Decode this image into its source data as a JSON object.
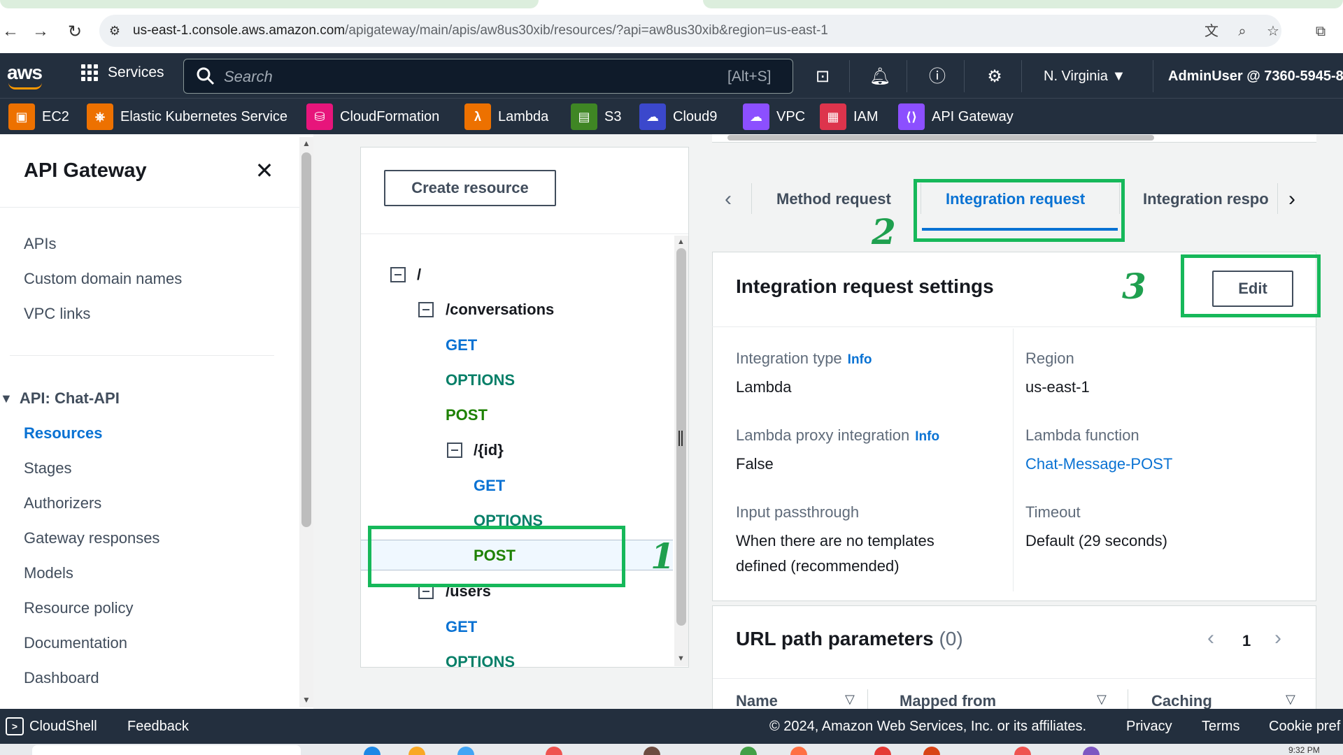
{
  "browser": {
    "url_host": "us-east-1.console.aws.amazon.com",
    "url_path": "/apigateway/main/apis/aw8us30xib/resources/?api=aw8us30xib&region=us-east-1",
    "back_icon": "arrow-left-icon",
    "forward_icon": "arrow-right-icon",
    "reload_icon": "reload-icon",
    "translate_icon": "translate-icon",
    "zoom_icon": "zoom-icon",
    "bookmark_icon": "star-icon",
    "extensions_icon": "puzzle-icon"
  },
  "awsnav": {
    "logo": "aws",
    "services_label": "Services",
    "search_placeholder": "Search",
    "search_shortcut": "[Alt+S]",
    "region_label": "N. Virginia ▼",
    "account_label": "AdminUser @ 7360-5945-8"
  },
  "favorites": [
    {
      "label": "EC2",
      "color": "#ed7100",
      "glyph": "▣"
    },
    {
      "label": "Elastic Kubernetes Service",
      "color": "#ed7100",
      "glyph": "⎈"
    },
    {
      "label": "CloudFormation",
      "color": "#e7157b",
      "glyph": "⛁"
    },
    {
      "label": "Lambda",
      "color": "#ed7100",
      "glyph": "λ"
    },
    {
      "label": "S3",
      "color": "#3f8624",
      "glyph": "▤"
    },
    {
      "label": "Cloud9",
      "color": "#3b48cc",
      "glyph": "☁"
    },
    {
      "label": "VPC",
      "color": "#8c4fff",
      "glyph": "☁"
    },
    {
      "label": "IAM",
      "color": "#dd344c",
      "glyph": "▦"
    },
    {
      "label": "API Gateway",
      "color": "#8c4fff",
      "glyph": "⟨⟩"
    }
  ],
  "sidebar": {
    "title": "API Gateway",
    "top_items": [
      "APIs",
      "Custom domain names",
      "VPC links"
    ],
    "group_label": "API: Chat-API",
    "group_items": [
      "Resources",
      "Stages",
      "Authorizers",
      "Gateway responses",
      "Models",
      "Resource policy",
      "Documentation",
      "Dashboard"
    ]
  },
  "resources": {
    "create_label": "Create resource",
    "tree": {
      "root": "/",
      "conversations": "/conversations",
      "conv_get": "GET",
      "conv_options": "OPTIONS",
      "conv_post": "POST",
      "id": "/{id}",
      "id_get": "GET",
      "id_options": "OPTIONS",
      "id_post": "POST",
      "users": "/users",
      "users_get": "GET",
      "users_options": "OPTIONS"
    }
  },
  "tabs": {
    "method_request": "Method request",
    "integration_request": "Integration request",
    "integration_response": "Integration respo"
  },
  "detail": {
    "title": "Integration request settings",
    "edit_label": "Edit",
    "info_label": "Info",
    "integration_type_label": "Integration type",
    "integration_type_value": "Lambda",
    "region_label": "Region",
    "region_value": "us-east-1",
    "proxy_label": "Lambda proxy integration",
    "proxy_value": "False",
    "function_label": "Lambda function",
    "function_value": "Chat-Message-POST",
    "passthrough_label": "Input passthrough",
    "passthrough_value_1": "When there are no templates",
    "passthrough_value_2": "defined (recommended)",
    "timeout_label": "Timeout",
    "timeout_value": "Default (29 seconds)"
  },
  "params": {
    "title": "URL path parameters",
    "count": "(0)",
    "page": "1",
    "col_name": "Name",
    "col_mapped": "Mapped from",
    "col_caching": "Caching"
  },
  "footer": {
    "cloudshell": "CloudShell",
    "feedback": "Feedback",
    "copyright": "© 2024, Amazon Web Services, Inc. or its affiliates.",
    "privacy": "Privacy",
    "terms": "Terms",
    "cookie": "Cookie pref"
  },
  "taskbar": {
    "time": "9:32 PM"
  },
  "annotations": {
    "n1": "1",
    "n2": "2",
    "n3": "3",
    "color": "#16b85a"
  }
}
